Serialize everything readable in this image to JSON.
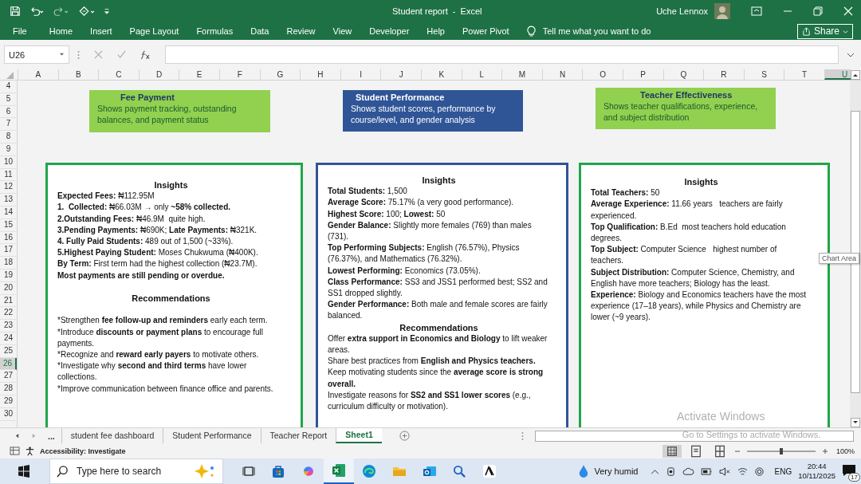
{
  "title_bar": {
    "title": "Student report  -  Excel",
    "user": "Uche Lennox"
  },
  "ribbon_tabs": [
    "File",
    "Home",
    "Insert",
    "Page Layout",
    "Formulas",
    "Data",
    "Review",
    "View",
    "Developer",
    "Help",
    "Power Pivot"
  ],
  "tell_me": {
    "placeholder": "Tell me what you want to do"
  },
  "share_button": "Share",
  "name_box": "U26",
  "columns": [
    {
      "label": "A",
      "selected": false
    },
    {
      "label": "B",
      "selected": false
    },
    {
      "label": "C",
      "selected": false
    },
    {
      "label": "D",
      "selected": false
    },
    {
      "label": "E",
      "selected": false
    },
    {
      "label": "F",
      "selected": false
    },
    {
      "label": "G",
      "selected": false
    },
    {
      "label": "H",
      "selected": false
    },
    {
      "label": "I",
      "selected": false
    },
    {
      "label": "J",
      "selected": false
    },
    {
      "label": "K",
      "selected": false
    },
    {
      "label": "L",
      "selected": false
    },
    {
      "label": "M",
      "selected": false
    },
    {
      "label": "N",
      "selected": false
    },
    {
      "label": "O",
      "selected": false
    },
    {
      "label": "P",
      "selected": false
    },
    {
      "label": "Q",
      "selected": false
    },
    {
      "label": "R",
      "selected": false
    },
    {
      "label": "S",
      "selected": false
    },
    {
      "label": "T",
      "selected": false
    },
    {
      "label": "U",
      "selected": true
    }
  ],
  "rows": [
    {
      "label": "4",
      "selected": false
    },
    {
      "label": "5",
      "selected": false
    },
    {
      "label": "6",
      "selected": false
    },
    {
      "label": "7",
      "selected": false
    },
    {
      "label": "8",
      "selected": false
    },
    {
      "label": "9",
      "selected": false
    },
    {
      "label": "10",
      "selected": false
    },
    {
      "label": "11",
      "selected": false
    },
    {
      "label": "12",
      "selected": false
    },
    {
      "label": "13",
      "selected": false
    },
    {
      "label": "14",
      "selected": false
    },
    {
      "label": "15",
      "selected": false
    },
    {
      "label": "16",
      "selected": false
    },
    {
      "label": "17",
      "selected": false
    },
    {
      "label": "18",
      "selected": false
    },
    {
      "label": "19",
      "selected": false
    },
    {
      "label": "20",
      "selected": false
    },
    {
      "label": "21",
      "selected": false
    },
    {
      "label": "22",
      "selected": false
    },
    {
      "label": "23",
      "selected": false
    },
    {
      "label": "24",
      "selected": false
    },
    {
      "label": "25",
      "selected": false
    },
    {
      "label": "26",
      "selected": true
    },
    {
      "label": "27",
      "selected": false
    },
    {
      "label": "28",
      "selected": false
    },
    {
      "label": "29",
      "selected": false
    },
    {
      "label": "30",
      "selected": false
    }
  ],
  "header_cards": [
    {
      "title": "Fee Payment",
      "description": "Shows payment tracking, outstanding balances, and payment status",
      "color": "#92d050"
    },
    {
      "title": "Student Performance",
      "description": "Shows student scores, performance by course/level, and gender analysis",
      "color": "#2f5597"
    },
    {
      "title": "Teacher Effectiveness",
      "description": "Shows teacher qualifications, experience, and subject distribution",
      "color": "#92d050"
    }
  ],
  "insight_boxes": [
    {
      "color": "#1fa64a",
      "lines": [
        {
          "kind": "heading",
          "text": "Insights"
        },
        {
          "kind": "text",
          "text": "**Expected Fees:** ₦112.95M"
        },
        {
          "kind": "text",
          "text": "**1.  Collected:** ₦66.03M → only **~58% collected.**"
        },
        {
          "kind": "text",
          "text": "**2.Outstanding Fees:** ₦46.9M  quite high."
        },
        {
          "kind": "text",
          "text": "**3.Pending Payments:** ₦690K; **Late Payments:** ₦321K."
        },
        {
          "kind": "text",
          "text": "**4. Fully Paid Students:** 489 out of 1,500 (~33%)."
        },
        {
          "kind": "text",
          "text": "**5.Highest Paying Student:** Moses Chukwuma (₦400K)."
        },
        {
          "kind": "text",
          "text": "**By Term:** First term had the highest collection (₦23.7M)."
        },
        {
          "kind": "bold",
          "text": "Most payments are still pending or overdue."
        },
        {
          "kind": "blank"
        },
        {
          "kind": "heading",
          "text": "Recommendations"
        },
        {
          "kind": "blank"
        },
        {
          "kind": "bullet",
          "marker": "*",
          "text": "Strengthen **fee follow-up and reminders** early each term."
        },
        {
          "kind": "bullet",
          "marker": "*",
          "text": "Introduce **discounts or payment plans** to encourage full payments."
        },
        {
          "kind": "bullet",
          "marker": "*",
          "text": "Recognize and **reward early payers** to motivate others."
        },
        {
          "kind": "bullet",
          "marker": "*",
          "text": "Investigate why **second and third terms** have lower collections."
        },
        {
          "kind": "bullet",
          "marker": "*",
          "text": "Improve communication between finance office and parents."
        }
      ]
    },
    {
      "color": "#2f5597",
      "lines": [
        {
          "kind": "heading",
          "text": "Insights"
        },
        {
          "kind": "text",
          "text": "**Total Students:** 1,500"
        },
        {
          "kind": "text",
          "text": "**Average Score:** 75.17% (a very good performance)."
        },
        {
          "kind": "text",
          "text": "**Highest Score:** 100; **Lowest:** 50"
        },
        {
          "kind": "text",
          "text": "**Gender Balance:** Slightly more females (769) than males (731)."
        },
        {
          "kind": "text",
          "text": "**Top Performing Subjects:** English (76.57%), Physics (76.37%), and Mathematics (76.32%)."
        },
        {
          "kind": "text",
          "text": "**Lowest Performing:** Economics (73.05%)."
        },
        {
          "kind": "text",
          "text": "**Class Performance:** SS3 and JSS1 performed best; SS2 and SS1 dropped slightly."
        },
        {
          "kind": "text",
          "text": "**Gender Performance:** Both male and female scores are fairly balanced."
        },
        {
          "kind": "heading",
          "text": "Recommendations"
        },
        {
          "kind": "text",
          "text": "Offer **extra support in Economics and Biology** to lift weaker areas."
        },
        {
          "kind": "text",
          "text": "Share best practices from **English and Physics teachers.**"
        },
        {
          "kind": "text",
          "text": "Keep motivating students since the **average score is strong overall.**"
        },
        {
          "kind": "text",
          "text": "Investigate reasons for **SS2 and SS1 lower scores** (e.g., curriculum difficulty or motivation)."
        }
      ]
    },
    {
      "color": "#1fa64a",
      "lines": [
        {
          "kind": "heading",
          "text": "Insights"
        },
        {
          "kind": "text",
          "text": "**Total Teachers:** 50"
        },
        {
          "kind": "text",
          "text": "**Average Experience:** 11.66 years   teachers are fairly experienced."
        },
        {
          "kind": "text",
          "text": "**Top Qualification:** B.Ed  most teachers hold education degrees."
        },
        {
          "kind": "text",
          "text": "**Top Subject:** Computer Science   highest number of teachers."
        },
        {
          "kind": "text",
          "text": "**Subject Distribution:** Computer Science, Chemistry, and English have more teachers; Biology has the least."
        },
        {
          "kind": "text",
          "text": "**Experience:** Biology and Economics teachers have the most experience (17–18 years), while Physics and Chemistry are lower (~9 years)."
        }
      ]
    }
  ],
  "tooltip": "Chart Area",
  "sheet_overflow": "...",
  "sheet_tabs": [
    {
      "label": "student fee dashboard",
      "selected": false
    },
    {
      "label": "Student Performance",
      "selected": false
    },
    {
      "label": "Teacher Report",
      "selected": false
    },
    {
      "label": "Sheet1",
      "selected": true
    }
  ],
  "status_bar": {
    "accessibility": "Accessibility: Investigate",
    "zoom": "100%",
    "zoom_slider": {
      "level": 0.5
    }
  },
  "activation_notice": {
    "title": "Activate Windows",
    "subtitle": "Go to Settings to activate Windows."
  },
  "taskbar": {
    "search": {
      "placeholder": "Type here to search"
    },
    "weather": "Very humid",
    "language": "ENG",
    "time": "20:44",
    "date": "10/11/2025",
    "notifications": "17"
  }
}
